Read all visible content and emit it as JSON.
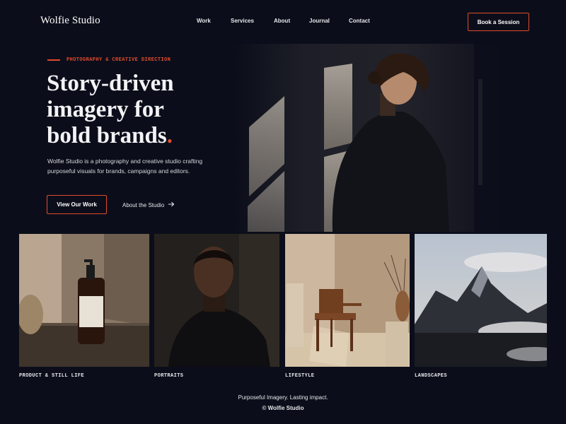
{
  "header": {
    "logo": "Wolfie Studio",
    "nav": [
      {
        "label": "Work"
      },
      {
        "label": "Services"
      },
      {
        "label": "About"
      },
      {
        "label": "Journal"
      },
      {
        "label": "Contact"
      }
    ],
    "cta_label": "Book a Session"
  },
  "hero": {
    "eyebrow": "PHOTOGRAPHY & CREATIVE DIRECTION",
    "headline_lines": [
      "Story-driven",
      "imagery for",
      "bold brands"
    ],
    "headline_dot": ".",
    "lede": "Wolfie Studio is a photography and creative studio crafting purposeful visuals for brands, campaigns and editors.",
    "primary_button": "View Our Work",
    "secondary_link": "About the Studio",
    "secondary_icon": "arrow-right-icon"
  },
  "gallery": [
    {
      "caption": "PRODUCT & STILL LIFE",
      "image": "product-bottle-photo"
    },
    {
      "caption": "PORTRAITS",
      "image": "portrait-photo"
    },
    {
      "caption": "LIFESTYLE",
      "image": "chair-interior-photo"
    },
    {
      "caption": "LANDSCAPES",
      "image": "mountain-photo"
    }
  ],
  "footer": {
    "tagline": "Purposeful Imagery. Lasting impact.",
    "copyright": "© Wolfie Studio"
  },
  "colors": {
    "background": "#0b0e1a",
    "accent": "#e14a2c",
    "text": "#e9e9ee"
  }
}
